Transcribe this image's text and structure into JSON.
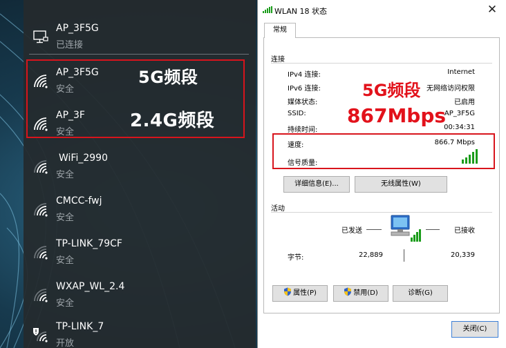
{
  "flyout": {
    "connected": {
      "ssid": "AP_3F5G",
      "status": "已连接",
      "icon": "network-monitor-icon"
    },
    "networks": [
      {
        "ssid": "AP_3F5G",
        "security": "安全",
        "icon": "wifi-signal-icon"
      },
      {
        "ssid": "AP_3F",
        "security": "安全",
        "icon": "wifi-signal-icon"
      },
      {
        "ssid": "WiFi_2990",
        "security": "安全",
        "icon": "wifi-signal-icon"
      },
      {
        "ssid": "CMCC-fwj",
        "security": "安全",
        "icon": "wifi-signal-icon"
      },
      {
        "ssid": "TP-LINK_79CF",
        "security": "安全",
        "icon": "wifi-signal-icon"
      },
      {
        "ssid": "WXAP_WL_2.4",
        "security": "安全",
        "icon": "wifi-signal-icon"
      },
      {
        "ssid": "TP-LINK_7",
        "security": "开放",
        "icon": "wifi-open-warning-icon"
      }
    ],
    "annotations": {
      "band_5g": "5G频段",
      "band_24g": "2.4G频段"
    }
  },
  "dialog": {
    "title": "WLAN 18 状态",
    "close_glyph": "✕",
    "tab": "常规",
    "connection": {
      "title": "连接",
      "rows": [
        {
          "label": "IPv4 连接:",
          "value": "Internet"
        },
        {
          "label": "IPv6 连接:",
          "value": "无网络访问权限"
        },
        {
          "label": "媒体状态:",
          "value": "已启用"
        },
        {
          "label": "SSID:",
          "value": "AP_3F5G"
        },
        {
          "label": "持续时间:",
          "value": "00:34:31"
        },
        {
          "label": "速度:",
          "value": "866.7 Mbps"
        },
        {
          "label": "信号质量:",
          "value": ""
        }
      ],
      "signal_bars": 5
    },
    "buttons": {
      "details": "详细信息(E)...",
      "wireless_props": "无线属性(W)"
    },
    "activity": {
      "title": "活动",
      "sent_label": "已发送",
      "received_label": "已接收",
      "bytes_label": "字节:",
      "bytes_sent": "22,889",
      "bytes_received": "20,339"
    },
    "bottom_buttons": {
      "properties": "属性(P)",
      "disable": "禁用(D)",
      "diagnose": "诊断(G)"
    },
    "close_button": "关闭(C)",
    "annotations": {
      "band": "5G频段",
      "speed": "867Mbps"
    }
  },
  "colors": {
    "annotation_red": "#e2121b",
    "box_red": "#d8141c",
    "flyout_bg": "#242a2e",
    "signal_green": "#1a9c1a"
  }
}
